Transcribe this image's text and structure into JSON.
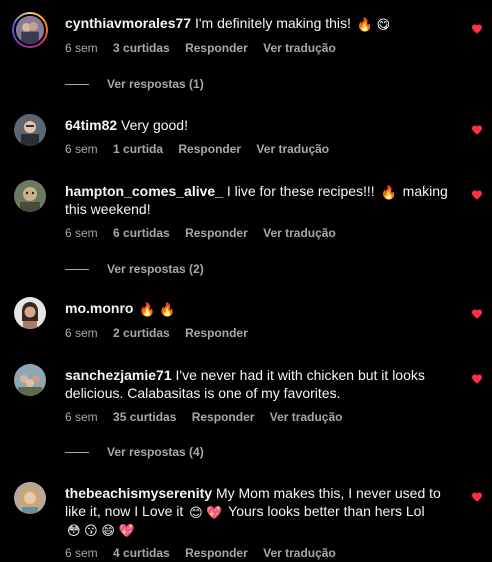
{
  "comments": [
    {
      "username": "cynthiavmorales77",
      "text": "I'm definitely making this!",
      "emojis": "🔥 😋",
      "time": "6 sem",
      "likes": "3 curtidas",
      "reply": "Responder",
      "translate": "Ver tradução",
      "view_replies": "Ver respostas (1)"
    },
    {
      "username": "64tim82",
      "text": "Very good!",
      "time": "6 sem",
      "likes": "1 curtida",
      "reply": "Responder",
      "translate": "Ver tradução"
    },
    {
      "username": "hampton_comes_alive_",
      "text": "I live for these recipes!!!",
      "emojis": "🔥",
      "text2": "making this weekend!",
      "time": "6 sem",
      "likes": "6 curtidas",
      "reply": "Responder",
      "translate": "Ver tradução",
      "view_replies": "Ver respostas (2)"
    },
    {
      "username": "mo.monro",
      "emojis": "🔥 🔥",
      "time": "6 sem",
      "likes": "2 curtidas",
      "reply": "Responder"
    },
    {
      "username": "sanchezjamie71",
      "text": "I've never had it with chicken but it looks delicious. Calabasitas is one of my favorites.",
      "time": "6 sem",
      "likes": "35 curtidas",
      "reply": "Responder",
      "translate": "Ver tradução",
      "view_replies": "Ver respostas (4)"
    },
    {
      "username": "thebeachismyserenity",
      "text": "My Mom makes this, I never used to like it, now I Love it",
      "emojis": "😊 💖",
      "text2": "Yours looks better than hers Lol",
      "emojis2": "😳 😗 😄 💖",
      "time": "6 sem",
      "likes": "4 curtidas",
      "reply": "Responder",
      "translate": "Ver tradução"
    }
  ],
  "colors": {
    "like": "#ff3040",
    "meta": "#a8a8a8",
    "text": "#f5f5f5",
    "background": "#000000"
  }
}
